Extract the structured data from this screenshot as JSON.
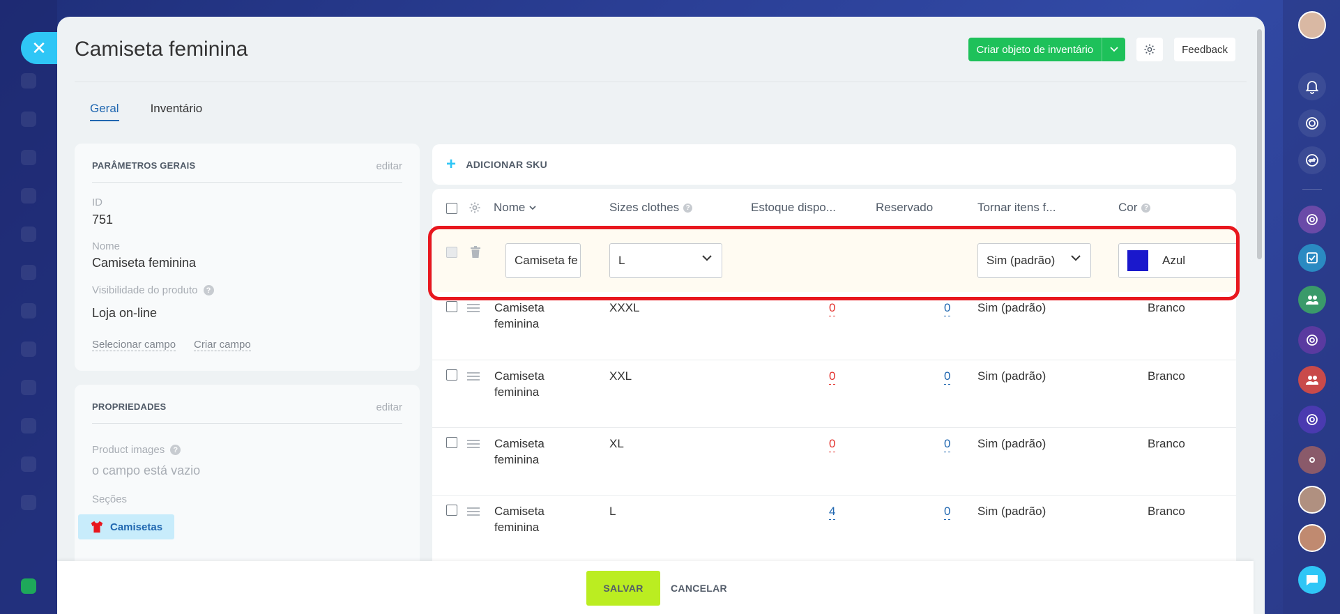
{
  "window": {
    "close_icon": "close-icon"
  },
  "page": {
    "title": "Camiseta feminina"
  },
  "header": {
    "create_label": "Criar objeto de inventário",
    "feedback_label": "Feedback",
    "accent": "#1ec15a"
  },
  "tabs": [
    {
      "label": "Geral",
      "active": true
    },
    {
      "label": "Inventário",
      "active": false
    }
  ],
  "general": {
    "heading": "PARÂMETROS GERAIS",
    "edit": "editar",
    "id_label": "ID",
    "id_value": "751",
    "name_label": "Nome",
    "name_value": "Camiseta feminina",
    "visibility_label": "Visibilidade do produto",
    "visibility_value": "Loja on-line",
    "select_field": "Selecionar campo",
    "create_field": "Criar campo"
  },
  "properties": {
    "heading": "PROPRIEDADES",
    "edit": "editar",
    "images_label": "Product images",
    "images_value": "o campo está vazio",
    "sections_label": "Seções",
    "section_tag": "Camisetas"
  },
  "sku": {
    "add_label": "ADICIONAR SKU",
    "columns": [
      "Nome",
      "Sizes clothes",
      "Estoque dispo...",
      "Reservado",
      "Tornar itens f...",
      "Cor"
    ],
    "editing_row": {
      "name": "Camiseta fe",
      "size": "L",
      "make_items": "Sim (padrão)",
      "color": "Azul",
      "color_hex": "#1a18cc"
    },
    "rows": [
      {
        "name_line1": "Camiseta",
        "name_line2": "feminina",
        "size": "XXXL",
        "stock": "0",
        "reserved": "0",
        "make_items": "Sim (padrão)",
        "color": "Branco"
      },
      {
        "name_line1": "Camiseta",
        "name_line2": "feminina",
        "size": "XXL",
        "stock": "0",
        "reserved": "0",
        "make_items": "Sim (padrão)",
        "color": "Branco"
      },
      {
        "name_line1": "Camiseta",
        "name_line2": "feminina",
        "size": "XL",
        "stock": "0",
        "reserved": "0",
        "make_items": "Sim (padrão)",
        "color": "Branco"
      },
      {
        "name_line1": "Camiseta",
        "name_line2": "feminina",
        "size": "L",
        "stock": "4",
        "reserved": "0",
        "make_items": "Sim (padrão)",
        "color": "Branco"
      }
    ]
  },
  "footer": {
    "save": "SALVAR",
    "cancel": "CANCELAR"
  },
  "colors": {
    "save": "#bbed21",
    "highlight": "#e8171e",
    "link": "#2067b0",
    "zero": "#e3342f"
  }
}
